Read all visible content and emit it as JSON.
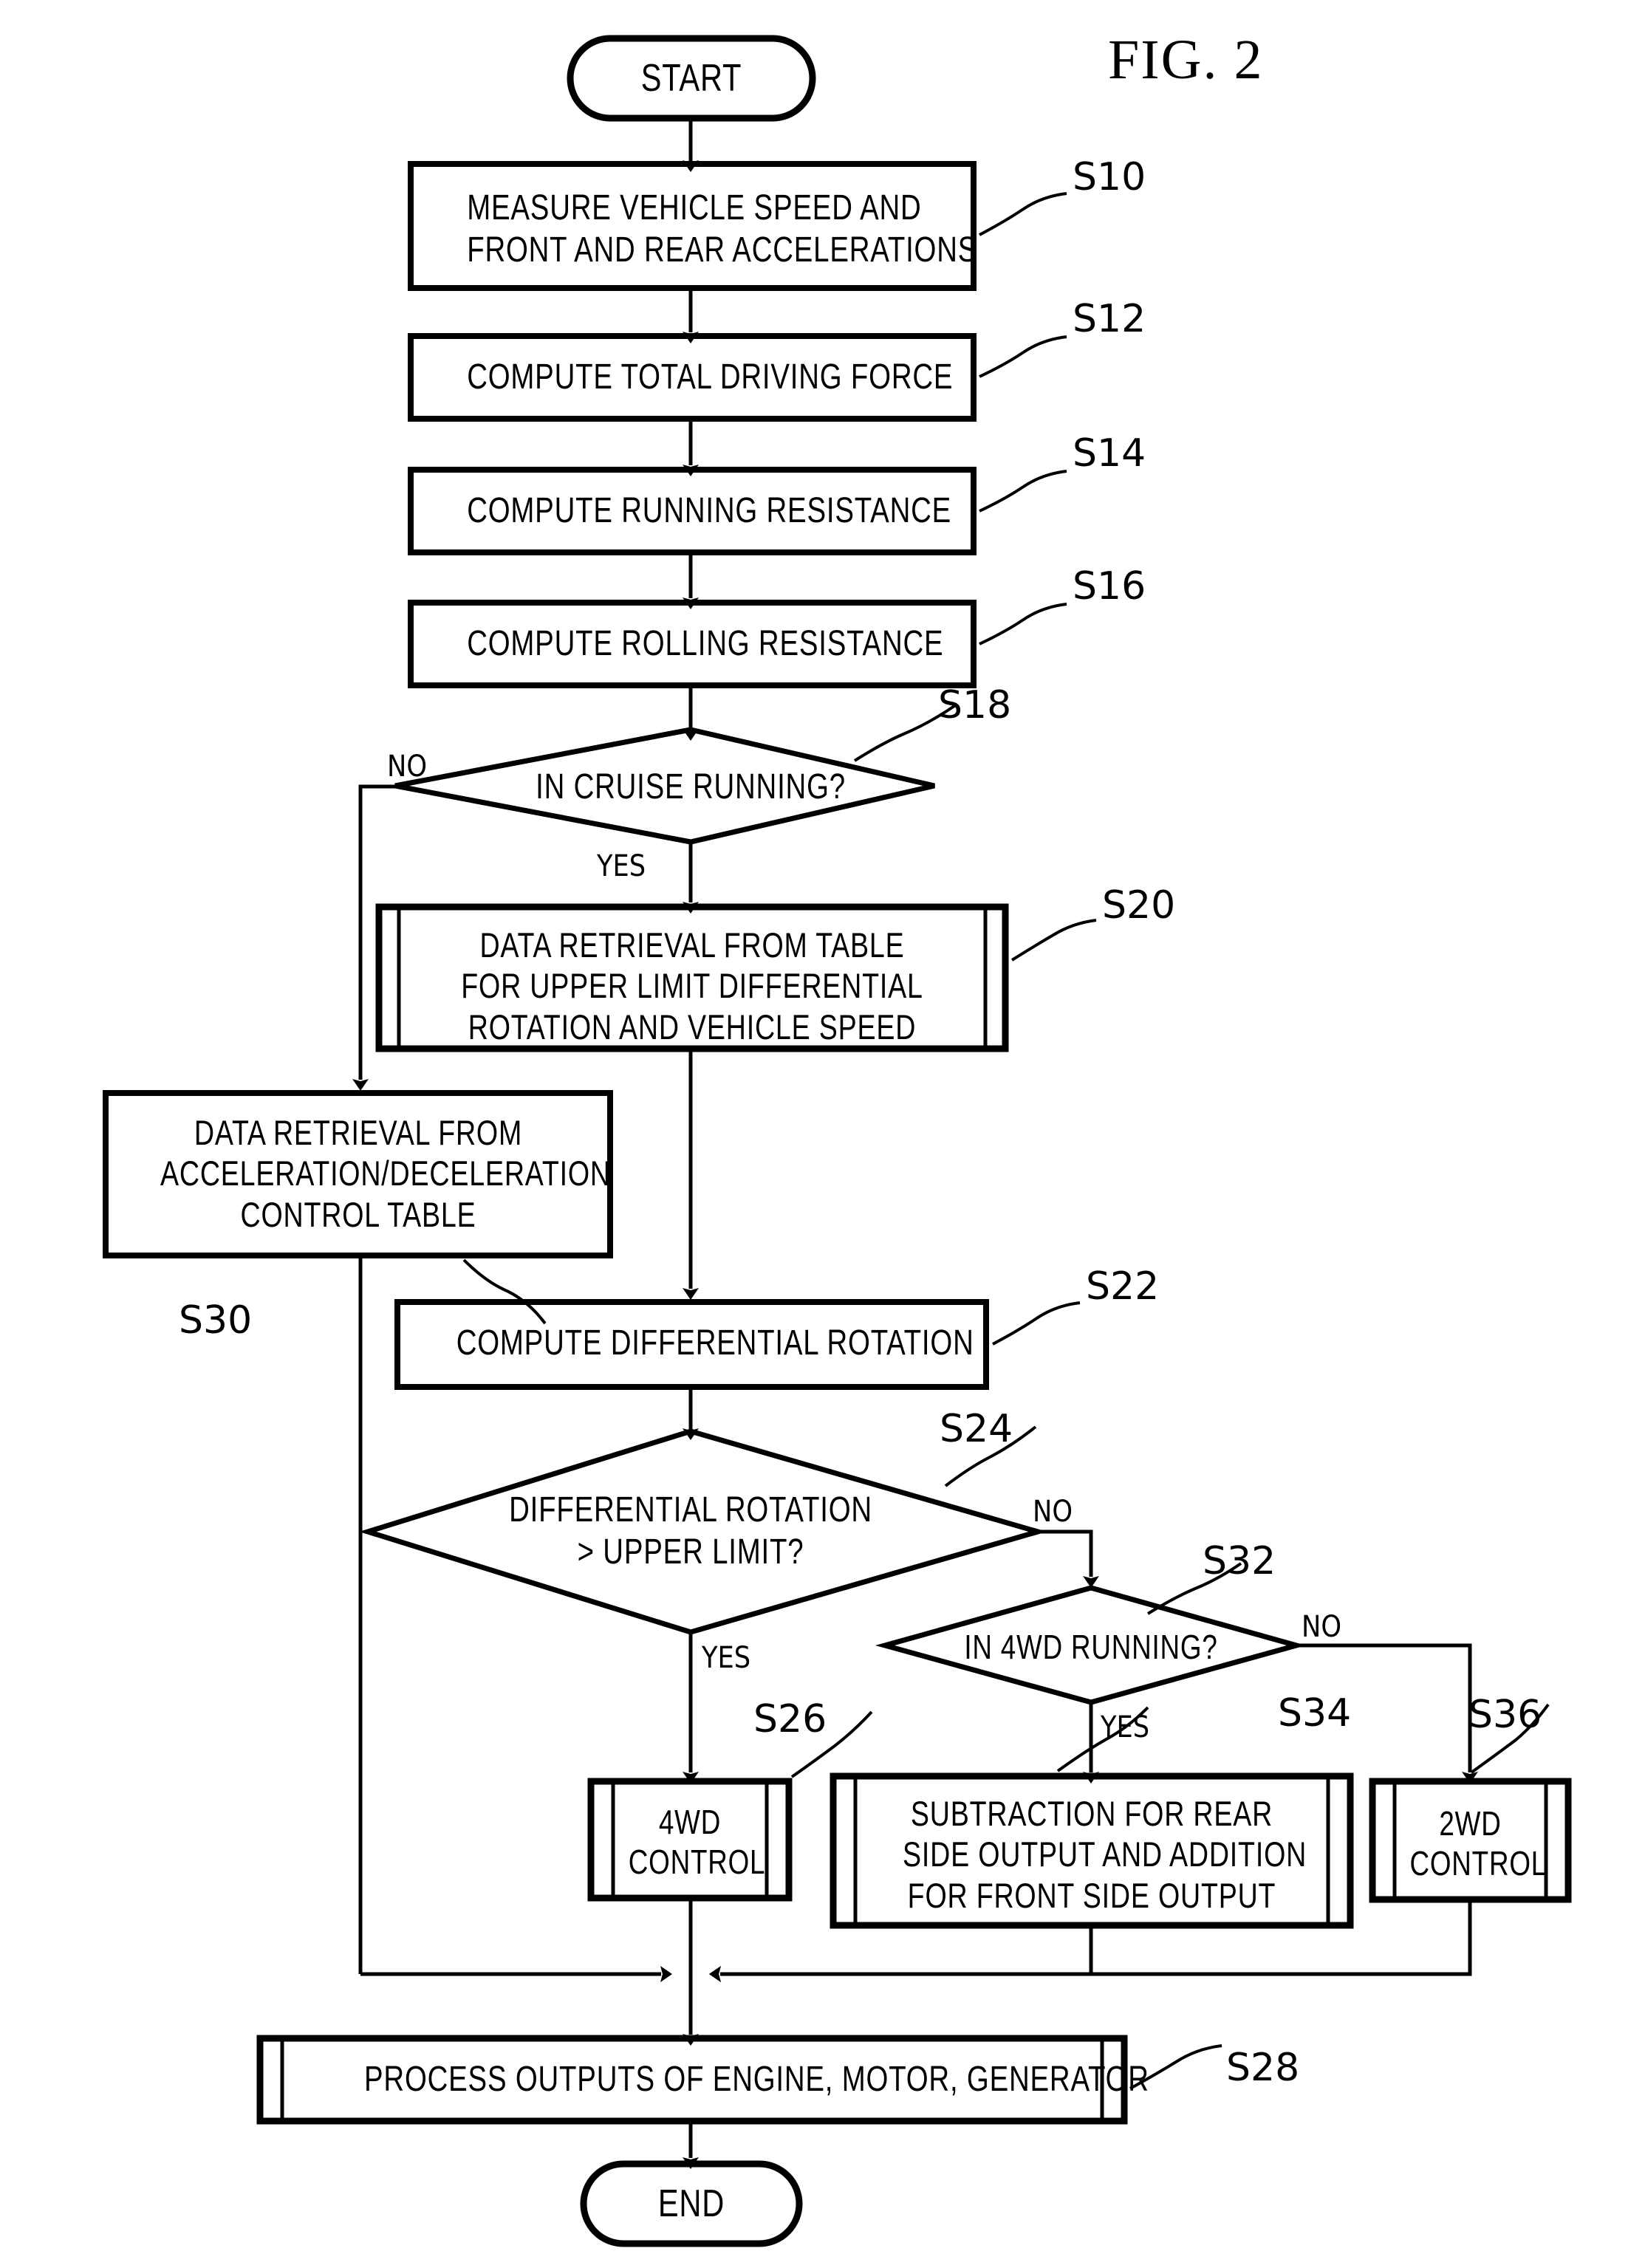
{
  "figure": {
    "title": "FIG. 2"
  },
  "terminators": {
    "start": "START",
    "end": "END"
  },
  "nodes": [
    {
      "id": "S10",
      "step": "S10",
      "text": "MEASURE VEHICLE SPEED AND\nFRONT AND REAR ACCELERATIONS",
      "shape": "process"
    },
    {
      "id": "S12",
      "step": "S12",
      "text": "COMPUTE TOTAL DRIVING FORCE",
      "shape": "process"
    },
    {
      "id": "S14",
      "step": "S14",
      "text": "COMPUTE RUNNING RESISTANCE",
      "shape": "process"
    },
    {
      "id": "S16",
      "step": "S16",
      "text": "COMPUTE ROLLING RESISTANCE",
      "shape": "process"
    },
    {
      "id": "S18",
      "step": "S18",
      "text": "IN CRUISE RUNNING?",
      "shape": "decision"
    },
    {
      "id": "S20",
      "step": "S20",
      "text": "DATA RETRIEVAL FROM TABLE\nFOR UPPER LIMIT DIFFERENTIAL\nROTATION AND VEHICLE SPEED",
      "shape": "predefined-process"
    },
    {
      "id": "S30",
      "step": "S30",
      "text": "DATA RETRIEVAL FROM\nACCELERATION/DECELERATION\nCONTROL TABLE",
      "shape": "process"
    },
    {
      "id": "S22",
      "step": "S22",
      "text": "COMPUTE DIFFERENTIAL ROTATION",
      "shape": "process"
    },
    {
      "id": "S24",
      "step": "S24",
      "text": "DIFFERENTIAL ROTATION\n> UPPER LIMIT?",
      "shape": "decision"
    },
    {
      "id": "S32",
      "step": "S32",
      "text": "IN 4WD RUNNING?",
      "shape": "decision"
    },
    {
      "id": "S26",
      "step": "S26",
      "text": "4WD\nCONTROL",
      "shape": "predefined-process"
    },
    {
      "id": "S34",
      "step": "S34",
      "text": "SUBTRACTION FOR REAR\nSIDE OUTPUT AND ADDITION\nFOR FRONT SIDE OUTPUT",
      "shape": "predefined-process"
    },
    {
      "id": "S36",
      "step": "S36",
      "text": "2WD\nCONTROL",
      "shape": "predefined-process"
    },
    {
      "id": "S28",
      "step": "S28",
      "text": "PROCESS OUTPUTS OF ENGINE, MOTOR, GENERATOR",
      "shape": "predefined-process"
    }
  ],
  "branch_labels": {
    "s18_no": "NO",
    "s18_yes": "YES",
    "s24_no": "NO",
    "s24_yes": "YES",
    "s32_no": "NO",
    "s32_yes": "YES"
  },
  "colors": {
    "ink": "#000000",
    "paper": "#ffffff"
  }
}
